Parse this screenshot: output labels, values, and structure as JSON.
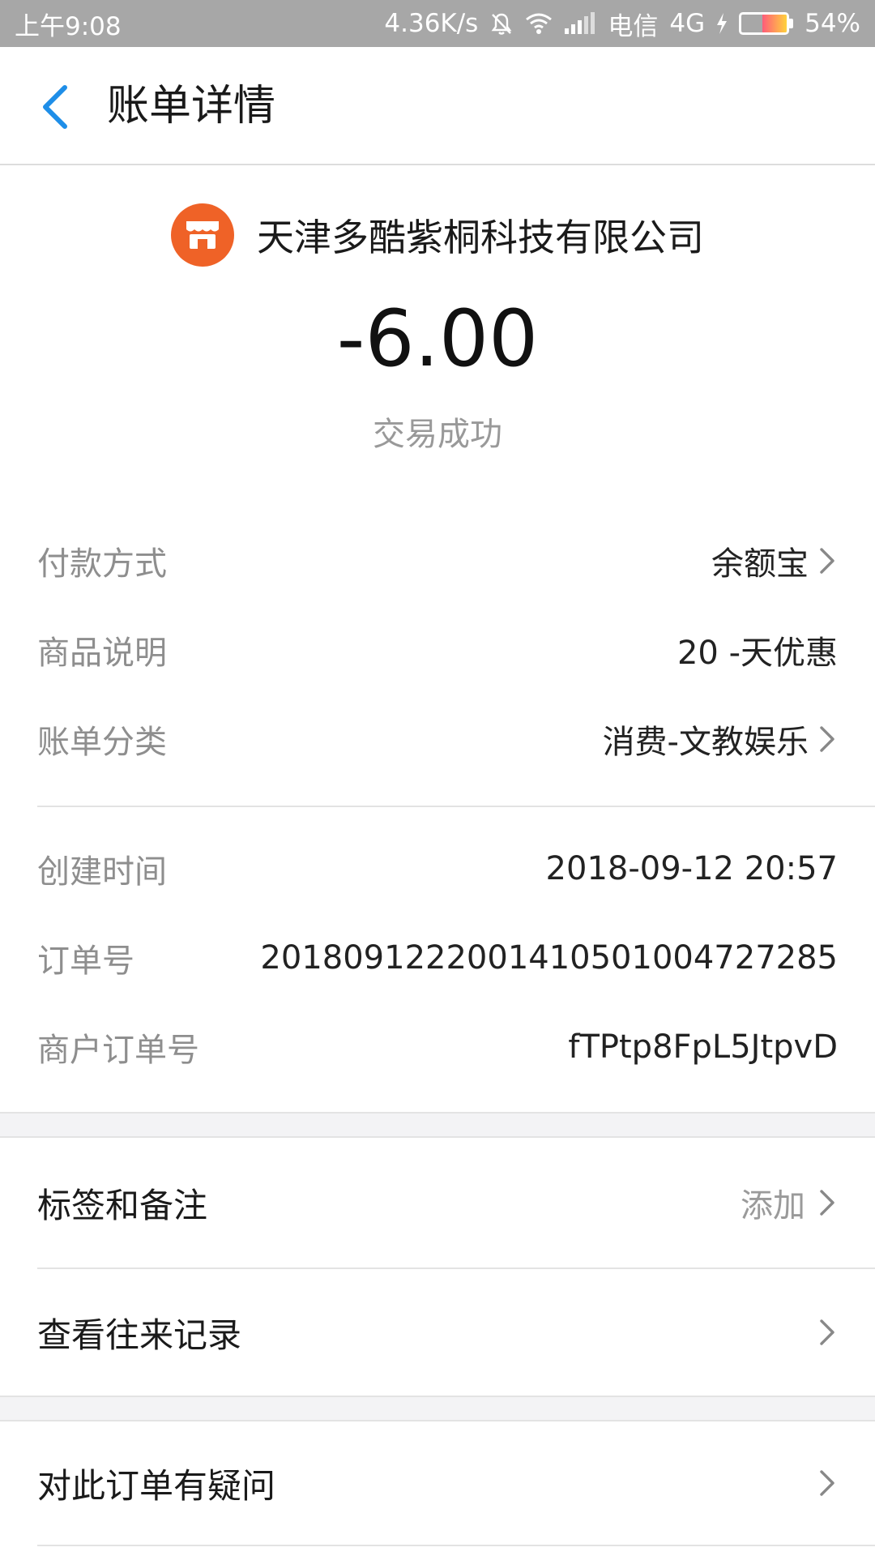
{
  "status_bar": {
    "time": "上午9:08",
    "speed": "4.36K/s",
    "carrier": "电信",
    "network": "4G",
    "battery": "54%",
    "battery_level": 0.54
  },
  "header": {
    "title": "账单详情"
  },
  "merchant": {
    "name": "天津多酷紫桐科技有限公司",
    "logo_color": "#ef6227"
  },
  "amount": "-6.00",
  "transaction_status": "交易成功",
  "details_group1": [
    {
      "label": "付款方式",
      "value": "余额宝",
      "has_chevron": true
    },
    {
      "label": "商品说明",
      "value": "20 -天优惠",
      "has_chevron": false
    },
    {
      "label": "账单分类",
      "value": "消费-文教娱乐",
      "has_chevron": true
    }
  ],
  "details_group2": [
    {
      "label": "创建时间",
      "value": "2018-09-12 20:57"
    },
    {
      "label": "订单号",
      "value": "2018091222001410501004727285"
    },
    {
      "label": "商户订单号",
      "value": "fTPtp8FpL5JtpvD"
    }
  ],
  "actions": {
    "tags": {
      "label": "标签和备注",
      "value": "添加"
    },
    "history": {
      "label": "查看往来记录"
    },
    "question": {
      "label": "对此订单有疑问"
    }
  },
  "colors": {
    "accent": "#1e8ee8",
    "status_bar": "#a7a7a7"
  }
}
